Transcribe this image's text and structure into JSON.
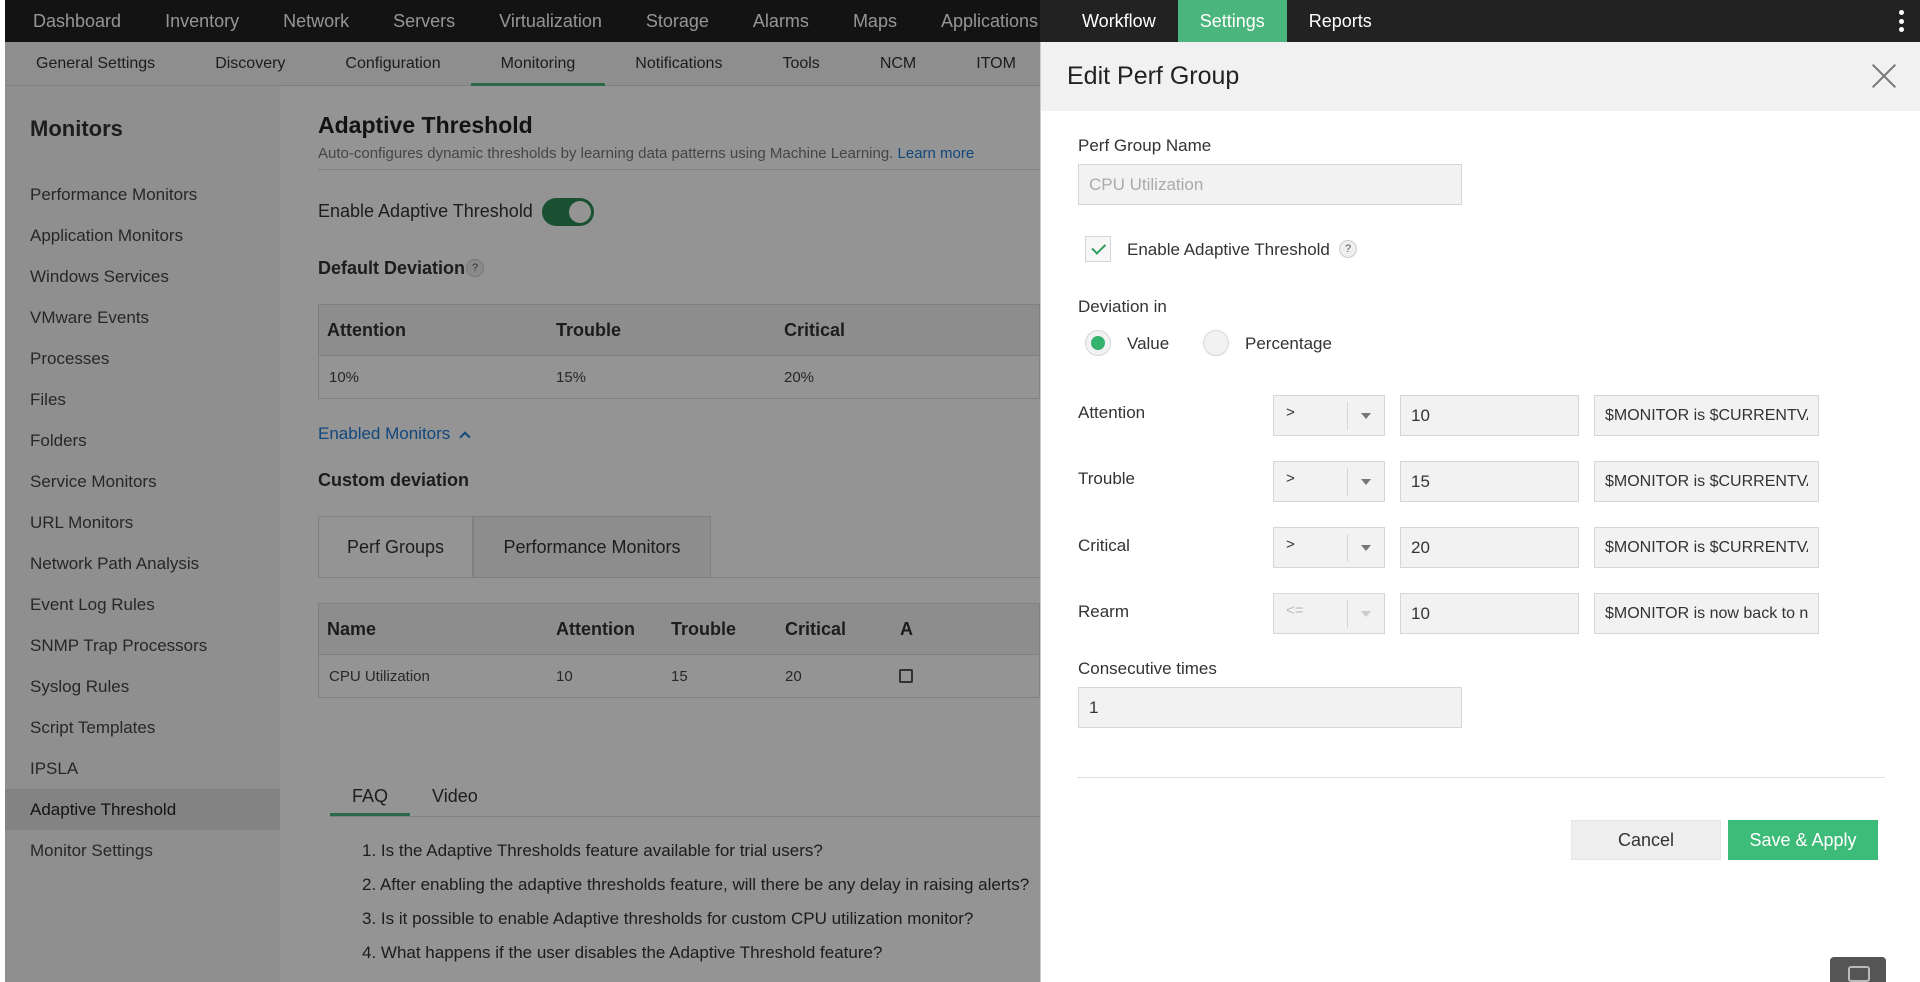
{
  "topnav": {
    "items": [
      {
        "label": "Dashboard"
      },
      {
        "label": "Inventory"
      },
      {
        "label": "Network"
      },
      {
        "label": "Servers"
      },
      {
        "label": "Virtualization"
      },
      {
        "label": "Storage"
      },
      {
        "label": "Alarms"
      },
      {
        "label": "Maps"
      },
      {
        "label": "Applications"
      },
      {
        "label": "Workflow"
      },
      {
        "label": "Settings"
      },
      {
        "label": "Reports"
      }
    ],
    "active": "Settings",
    "accent_color": "#4ab57c"
  },
  "subnav": {
    "items": [
      {
        "label": "General Settings"
      },
      {
        "label": "Discovery"
      },
      {
        "label": "Configuration"
      },
      {
        "label": "Monitoring"
      },
      {
        "label": "Notifications"
      },
      {
        "label": "Tools"
      },
      {
        "label": "NCM"
      },
      {
        "label": "ITOM"
      }
    ],
    "active": "Monitoring"
  },
  "sidebar": {
    "title": "Monitors",
    "items": [
      {
        "label": "Performance Monitors"
      },
      {
        "label": "Application Monitors"
      },
      {
        "label": "Windows Services"
      },
      {
        "label": "VMware Events"
      },
      {
        "label": "Processes"
      },
      {
        "label": "Files"
      },
      {
        "label": "Folders"
      },
      {
        "label": "Service Monitors"
      },
      {
        "label": "URL Monitors"
      },
      {
        "label": "Network Path Analysis"
      },
      {
        "label": "Event Log Rules"
      },
      {
        "label": "SNMP Trap Processors"
      },
      {
        "label": "Syslog Rules"
      },
      {
        "label": "Script Templates"
      },
      {
        "label": "IPSLA"
      },
      {
        "label": "Adaptive Threshold"
      },
      {
        "label": "Monitor Settings"
      }
    ],
    "active": "Adaptive Threshold"
  },
  "main": {
    "title": "Adaptive Threshold",
    "subtitle": "Auto-configures dynamic thresholds by learning data patterns using Machine Learning.",
    "learn_more": "Learn more",
    "enable_label": "Enable Adaptive Threshold",
    "enable_on": true,
    "default_deviation_label": "Default Deviation",
    "help_glyph": "?",
    "default_table": {
      "headers": [
        "Attention",
        "Trouble",
        "Critical"
      ],
      "row": [
        "10%",
        "15%",
        "20%"
      ]
    },
    "enabled_monitors_label": "Enabled Monitors",
    "custom_deviation_label": "Custom deviation",
    "tabs": [
      {
        "label": "Perf Groups"
      },
      {
        "label": "Performance Monitors"
      }
    ],
    "custom_table": {
      "headers": [
        "Name",
        "Attention",
        "Trouble",
        "Critical",
        "A"
      ],
      "row": [
        "CPU Utilization",
        "10",
        "15",
        "20"
      ]
    },
    "faq_tabs": [
      {
        "label": "FAQ"
      },
      {
        "label": "Video"
      }
    ],
    "faq": [
      "1. Is the Adaptive Thresholds feature available for trial users?",
      "2. After enabling the adaptive thresholds feature, will there be any delay in raising alerts?",
      "3. Is it possible to enable Adaptive thresholds for custom CPU utilization monitor?",
      "4. What happens if the user disables the Adaptive Threshold feature?"
    ]
  },
  "panel": {
    "title": "Edit Perf Group",
    "perf_group_name_label": "Perf Group Name",
    "perf_group_name_value": "CPU Utilization",
    "enable_label": "Enable Adaptive Threshold",
    "enable_checked": true,
    "deviation_in_label": "Deviation in",
    "radio_value": "Value",
    "radio_percentage": "Percentage",
    "rows": [
      {
        "label": "Attention",
        "operator": ">",
        "value": "10",
        "message": "$MONITOR is $CURRENTVALUE"
      },
      {
        "label": "Trouble",
        "operator": ">",
        "value": "15",
        "message": "$MONITOR is $CURRENTVALUE"
      },
      {
        "label": "Critical",
        "operator": ">",
        "value": "20",
        "message": "$MONITOR is $CURRENTVALUE"
      },
      {
        "label": "Rearm",
        "operator": "<=",
        "value": "10",
        "message": "$MONITOR is now back to normal"
      }
    ],
    "consecutive_label": "Consecutive times",
    "consecutive_value": "1",
    "cancel_label": "Cancel",
    "save_label": "Save & Apply",
    "save_color": "#3dbb78"
  }
}
